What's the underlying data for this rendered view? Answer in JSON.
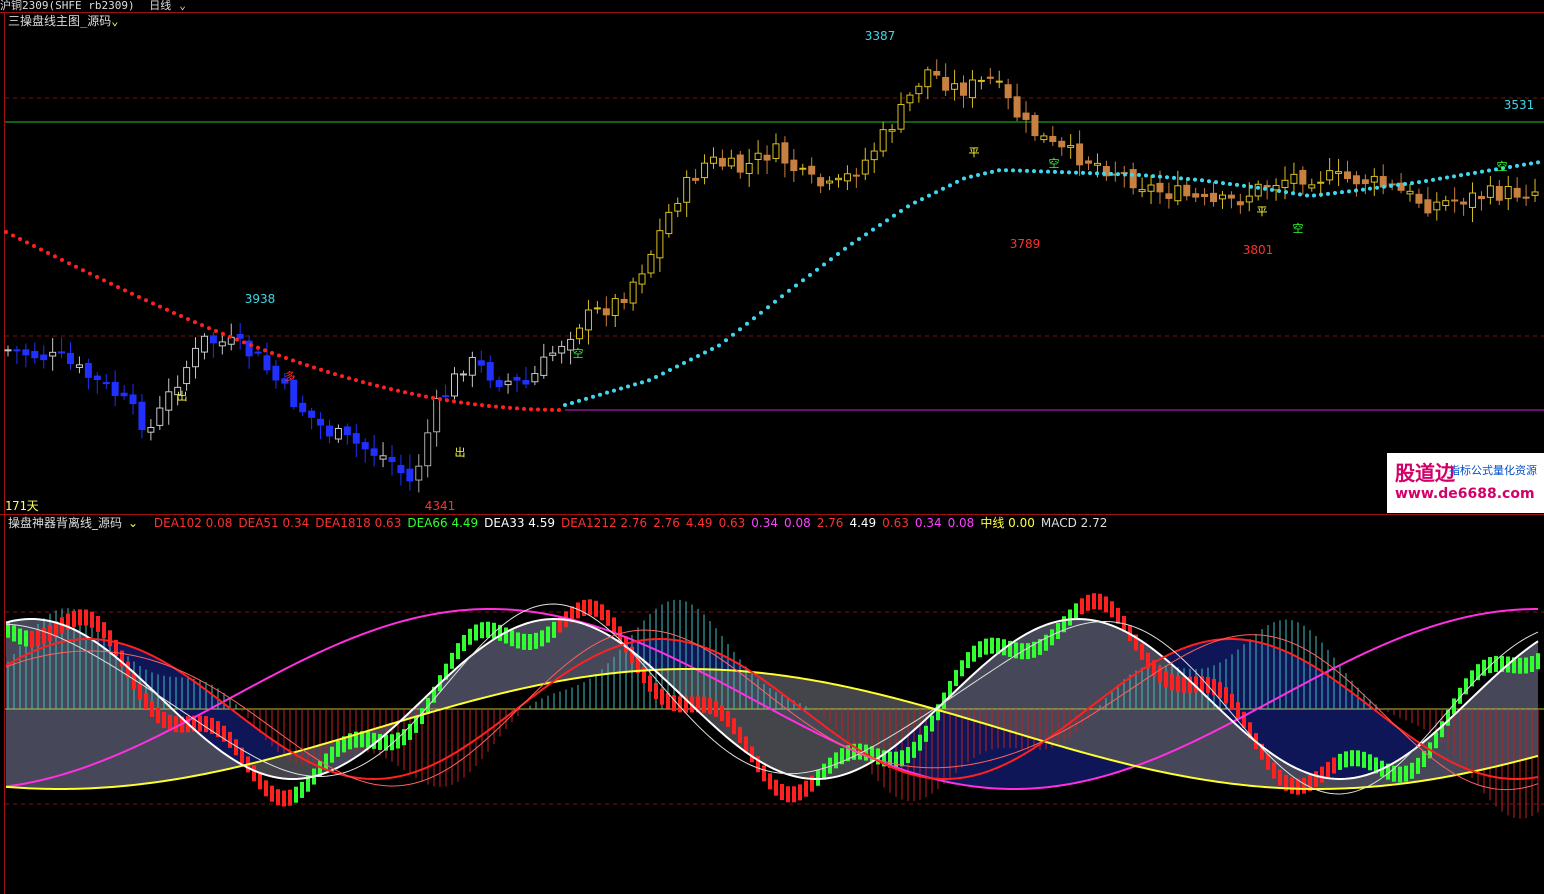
{
  "header": {
    "symbol": "沪铜2309(SHFE rb2309)",
    "period": "日线",
    "period_arrow": "⌄"
  },
  "top_panel": {
    "title": "三操盘线主图_源码",
    "title_arrow": "⌄",
    "days_label": "171天",
    "annotations": [
      {
        "text": "3387",
        "color": "#3dd8e8"
      },
      {
        "text": "3938",
        "color": "#3dd8e8"
      },
      {
        "text": "3531",
        "color": "#3dd8e8"
      },
      {
        "text": "4341",
        "color": "#ff3030"
      },
      {
        "text": "3789",
        "color": "#ff3030"
      },
      {
        "text": "3801",
        "color": "#ff3030"
      }
    ],
    "signals": [
      {
        "text": "出",
        "color": "#ffff40"
      },
      {
        "text": "出",
        "color": "#ffff40"
      },
      {
        "text": "多",
        "color": "#ff3030"
      },
      {
        "text": "空",
        "color": "#30ff30"
      },
      {
        "text": "平",
        "color": "#ffff40"
      },
      {
        "text": "空",
        "color": "#30ff30"
      },
      {
        "text": "平",
        "color": "#ffff40"
      },
      {
        "text": "空",
        "color": "#30ff30"
      },
      {
        "text": "空",
        "color": "#30ff30"
      }
    ]
  },
  "bottom_panel": {
    "title": "操盘神器背离线_源码",
    "title_arrow": "⌄",
    "legend": [
      {
        "text": "DEA102 0.08",
        "color": "#ff3030"
      },
      {
        "text": "DEA51 0.34",
        "color": "#ff3030"
      },
      {
        "text": "DEA1818 0.63",
        "color": "#ff3030"
      },
      {
        "text": "DEA66 4.49",
        "color": "#30ff30"
      },
      {
        "text": "DEA33 4.59",
        "color": "#ffffff"
      },
      {
        "text": "DEA1212 2.76",
        "color": "#ff3030"
      },
      {
        "text": "2.76",
        "color": "#ff3030"
      },
      {
        "text": "4.49",
        "color": "#ff3030"
      },
      {
        "text": "0.63",
        "color": "#ff3030"
      },
      {
        "text": "0.34",
        "color": "#ff40ff"
      },
      {
        "text": "0.08",
        "color": "#ff40ff"
      },
      {
        "text": "2.76",
        "color": "#ff3030"
      },
      {
        "text": "4.49",
        "color": "#ffffff"
      },
      {
        "text": "0.63",
        "color": "#ff3030"
      },
      {
        "text": "0.34",
        "color": "#ff40ff"
      },
      {
        "text": "0.08",
        "color": "#ff40ff"
      },
      {
        "text": "中线 0.00",
        "color": "#ffff40"
      },
      {
        "text": "MACD 2.72",
        "color": "#dddddd"
      }
    ]
  },
  "watermark": {
    "title": "股道边",
    "subtitle": "指标公式量化资源",
    "url": "www.de6688.com"
  },
  "colors": {
    "up_yellow": "#d8c020",
    "up_gray": "#c8c8c8",
    "down_orange": "#c88040",
    "down_blue": "#2030ff",
    "support_cyan": "#3dd8f0",
    "resist_red": "#ff2020",
    "hline_green": "#20c020",
    "hline_magenta": "#d020d0",
    "grid_red": "#801010",
    "hist_cyan": "#40c0c0",
    "hist_red": "#c02020"
  },
  "chart_data": [
    {
      "type": "candlestick",
      "title": "三操盘线主图_源码",
      "xlabel": "",
      "ylabel": "",
      "grid": true,
      "price_axis": "inverted",
      "ylim": [
        3280,
        4360
      ],
      "x": "bar index 0-171",
      "series": [
        {
          "name": "",
          "kind": "ohlc",
          "values": "generated"
        },
        {
          "name": "",
          "kind": "dotted-line",
          "values": "generated"
        }
      ],
      "points": [
        {
          "x": 142,
          "y": 3387,
          "label": "3387"
        },
        {
          "x": 23,
          "y": 3938,
          "label": "3938"
        },
        {
          "x": 168,
          "y": 3531,
          "label": "3531"
        },
        {
          "x": 47,
          "y": 4341,
          "label": "4341"
        },
        {
          "x": 111,
          "y": 3789,
          "label": "3789"
        },
        {
          "x": 137,
          "y": 3801,
          "label": "3801"
        }
      ]
    },
    {
      "type": "line",
      "title": "操盘神器背离线_源码",
      "xlabel": "",
      "ylabel": "",
      "grid": true,
      "ylim": [
        -9,
        9
      ],
      "series": [
        {
          "name": "DEA102",
          "value": 0.08
        },
        {
          "name": "DEA51",
          "value": 0.34
        },
        {
          "name": "DEA1818",
          "value": 0.63
        },
        {
          "name": "DEA66",
          "value": 4.49
        },
        {
          "name": "DEA33",
          "value": 4.59
        },
        {
          "name": "DEA1212",
          "value": 2.76
        },
        {
          "name": "中线",
          "value": 0.0
        },
        {
          "name": "MACD",
          "value": 2.72
        }
      ]
    }
  ]
}
